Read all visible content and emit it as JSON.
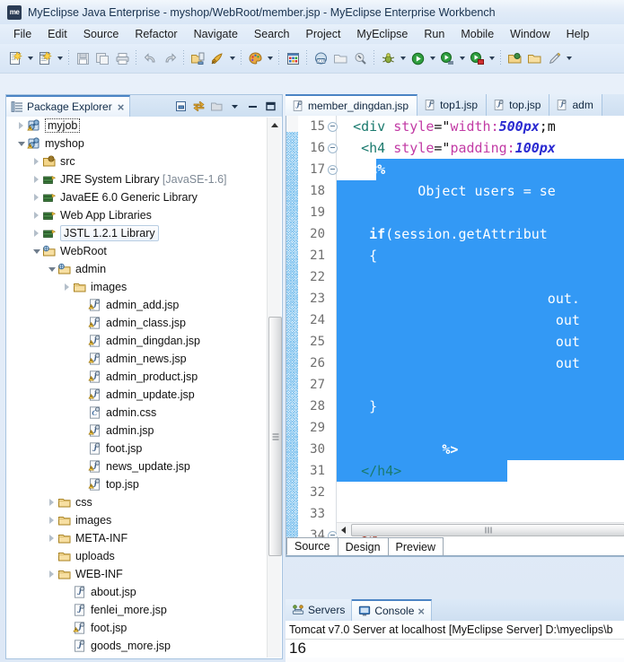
{
  "window": {
    "icon": "myeclipse-logo-icon",
    "title": "MyEclipse Java Enterprise - myshop/WebRoot/member.jsp - MyEclipse Enterprise Workbench"
  },
  "menubar": {
    "items": [
      {
        "label": "File"
      },
      {
        "label": "Edit"
      },
      {
        "label": "Source"
      },
      {
        "label": "Refactor"
      },
      {
        "label": "Navigate"
      },
      {
        "label": "Search"
      },
      {
        "label": "Project"
      },
      {
        "label": "MyEclipse"
      },
      {
        "label": "Run"
      },
      {
        "label": "Mobile"
      },
      {
        "label": "Window"
      },
      {
        "label": "Help"
      }
    ]
  },
  "toolbar": {
    "buttons": [
      {
        "name": "new-wizard-icon",
        "dropdown": true
      },
      {
        "name": "new-file-icon",
        "dropdown": true
      },
      {
        "name": "save-icon",
        "dropdown": false
      },
      {
        "name": "save-all-icon",
        "dropdown": false
      },
      {
        "name": "print-icon",
        "dropdown": false
      },
      {
        "name": "undo-icon",
        "dropdown": false
      },
      {
        "name": "redo-icon",
        "dropdown": false
      },
      {
        "name": "deploy-icon",
        "dropdown": false
      },
      {
        "name": "run-server-icon",
        "dropdown": true
      },
      {
        "name": "palette-icon",
        "dropdown": true
      },
      {
        "name": "database-explorer-icon",
        "dropdown": false
      },
      {
        "name": "web20-icon",
        "dropdown": false
      },
      {
        "name": "open-type-icon",
        "dropdown": false
      },
      {
        "name": "search-icon",
        "dropdown": false
      },
      {
        "name": "debug-icon",
        "dropdown": true
      },
      {
        "name": "run-icon",
        "dropdown": true
      },
      {
        "name": "run-external-icon",
        "dropdown": true
      },
      {
        "name": "run-profile-icon",
        "dropdown": true
      },
      {
        "name": "open-perspective-icon",
        "dropdown": false
      },
      {
        "name": "new-folder-icon",
        "dropdown": false
      },
      {
        "name": "edit-icon",
        "dropdown": true
      }
    ]
  },
  "package_explorer": {
    "tab_label": "Package Explorer",
    "tab_icon": "package-explorer-icon",
    "close_icon": "close-icon",
    "view_buttons": [
      {
        "name": "collapse-all-icon"
      },
      {
        "name": "link-with-editor-icon"
      },
      {
        "name": "focus-on-active-task-icon"
      },
      {
        "name": "view-menu-icon"
      },
      {
        "name": "minimize-view-icon"
      },
      {
        "name": "maximize-view-icon"
      }
    ],
    "tree": [
      {
        "label": "myjob",
        "indent": 0,
        "twisty": "collapsed",
        "icon": "java-project-warning-icon",
        "selected": "dotted"
      },
      {
        "label": "myshop",
        "indent": 0,
        "twisty": "expanded",
        "icon": "java-project-warning-icon"
      },
      {
        "label": "src",
        "indent": 1,
        "twisty": "collapsed",
        "icon": "source-folder-icon"
      },
      {
        "label": "JRE System Library",
        "suffix": " [JavaSE-1.6]",
        "indent": 1,
        "twisty": "collapsed",
        "icon": "library-icon"
      },
      {
        "label": "JavaEE 6.0 Generic Library",
        "indent": 1,
        "twisty": "collapsed",
        "icon": "library-icon"
      },
      {
        "label": "Web App Libraries",
        "indent": 1,
        "twisty": "collapsed",
        "icon": "library-icon"
      },
      {
        "label": "JSTL 1.2.1 Library",
        "indent": 1,
        "twisty": "collapsed",
        "icon": "library-icon",
        "selected": "box"
      },
      {
        "label": "WebRoot",
        "indent": 1,
        "twisty": "expanded",
        "icon": "web-folder-icon"
      },
      {
        "label": "admin",
        "indent": 2,
        "twisty": "expanded",
        "icon": "web-folder-icon"
      },
      {
        "label": "images",
        "indent": 3,
        "twisty": "collapsed",
        "icon": "folder-icon"
      },
      {
        "label": "admin_add.jsp",
        "indent": 4,
        "twisty": "none",
        "icon": "jsp-warning-icon"
      },
      {
        "label": "admin_class.jsp",
        "indent": 4,
        "twisty": "none",
        "icon": "jsp-warning-icon"
      },
      {
        "label": "admin_dingdan.jsp",
        "indent": 4,
        "twisty": "none",
        "icon": "jsp-warning-icon"
      },
      {
        "label": "admin_news.jsp",
        "indent": 4,
        "twisty": "none",
        "icon": "jsp-warning-icon"
      },
      {
        "label": "admin_product.jsp",
        "indent": 4,
        "twisty": "none",
        "icon": "jsp-warning-icon"
      },
      {
        "label": "admin_update.jsp",
        "indent": 4,
        "twisty": "none",
        "icon": "jsp-warning-icon"
      },
      {
        "label": "admin.css",
        "indent": 4,
        "twisty": "none",
        "icon": "css-icon"
      },
      {
        "label": "admin.jsp",
        "indent": 4,
        "twisty": "none",
        "icon": "jsp-warning-icon"
      },
      {
        "label": "foot.jsp",
        "indent": 4,
        "twisty": "none",
        "icon": "jsp-icon"
      },
      {
        "label": "news_update.jsp",
        "indent": 4,
        "twisty": "none",
        "icon": "jsp-warning-icon"
      },
      {
        "label": "top.jsp",
        "indent": 4,
        "twisty": "none",
        "icon": "jsp-warning-icon"
      },
      {
        "label": "css",
        "indent": 2,
        "twisty": "collapsed",
        "icon": "folder-icon"
      },
      {
        "label": "images",
        "indent": 2,
        "twisty": "collapsed",
        "icon": "folder-icon"
      },
      {
        "label": "META-INF",
        "indent": 2,
        "twisty": "collapsed",
        "icon": "folder-icon"
      },
      {
        "label": "uploads",
        "indent": 2,
        "twisty": "none",
        "icon": "folder-icon"
      },
      {
        "label": "WEB-INF",
        "indent": 2,
        "twisty": "collapsed",
        "icon": "folder-icon"
      },
      {
        "label": "about.jsp",
        "indent": 3,
        "twisty": "none",
        "icon": "jsp-icon"
      },
      {
        "label": "fenlei_more.jsp",
        "indent": 3,
        "twisty": "none",
        "icon": "jsp-icon"
      },
      {
        "label": "foot.jsp",
        "indent": 3,
        "twisty": "none",
        "icon": "jsp-warning-icon"
      },
      {
        "label": "goods_more.jsp",
        "indent": 3,
        "twisty": "none",
        "icon": "jsp-icon"
      }
    ]
  },
  "editor": {
    "tabs": [
      {
        "label": "member_dingdan.jsp",
        "icon": "jsp-icon",
        "active": true
      },
      {
        "label": "top1.jsp",
        "icon": "jsp-icon",
        "active": false
      },
      {
        "label": "top.jsp",
        "icon": "jsp-icon",
        "active": false
      },
      {
        "label": "adm",
        "icon": "jsp-icon",
        "active": false
      }
    ],
    "bottom_tabs": [
      {
        "label": "Source",
        "active": true
      },
      {
        "label": "Design",
        "active": false
      },
      {
        "label": "Preview",
        "active": false
      }
    ],
    "selection_color": "#3399f5",
    "lines": [
      {
        "num": "15",
        "fold": true,
        "segments": [
          {
            "t": "  ",
            "c": "tk-plain"
          },
          {
            "t": "<div ",
            "c": "tk-tag"
          },
          {
            "t": "style",
            "c": "tk-attr"
          },
          {
            "t": "=\"",
            "c": "tk-plain"
          },
          {
            "t": "width:",
            "c": "tk-attr"
          },
          {
            "t": "500px",
            "c": "tk-strI"
          },
          {
            "t": ";m",
            "c": "tk-plain"
          }
        ]
      },
      {
        "num": "16",
        "fold": true,
        "segments": [
          {
            "t": "   ",
            "c": "tk-plain"
          },
          {
            "t": "<h4 ",
            "c": "tk-tag"
          },
          {
            "t": "style",
            "c": "tk-attr"
          },
          {
            "t": "=\"",
            "c": "tk-plain"
          },
          {
            "t": "padding:",
            "c": "tk-attr"
          },
          {
            "t": "100px",
            "c": "tk-strI"
          }
        ]
      },
      {
        "num": "17",
        "fold": true,
        "segments": [
          {
            "t": "    <%",
            "c": "on-sel-b"
          }
        ]
      },
      {
        "num": "18",
        "fold": false,
        "segments": [
          {
            "t": "          Object users = se",
            "c": "on-sel"
          }
        ]
      },
      {
        "num": "19",
        "fold": false,
        "segments": []
      },
      {
        "num": "20",
        "fold": false,
        "segments": [
          {
            "t": "    if",
            "c": "on-sel-b"
          },
          {
            "t": "(session.getAttribut",
            "c": "on-sel"
          }
        ]
      },
      {
        "num": "21",
        "fold": false,
        "segments": [
          {
            "t": "    {",
            "c": "on-sel"
          }
        ]
      },
      {
        "num": "22",
        "fold": false,
        "segments": []
      },
      {
        "num": "23",
        "fold": false,
        "segments": [
          {
            "t": "                          out.",
            "c": "on-sel"
          }
        ]
      },
      {
        "num": "24",
        "fold": false,
        "segments": [
          {
            "t": "                           out",
            "c": "on-sel"
          }
        ]
      },
      {
        "num": "25",
        "fold": false,
        "segments": [
          {
            "t": "                           out",
            "c": "on-sel"
          }
        ]
      },
      {
        "num": "26",
        "fold": false,
        "segments": [
          {
            "t": "                           out",
            "c": "on-sel"
          }
        ]
      },
      {
        "num": "27",
        "fold": false,
        "segments": []
      },
      {
        "num": "28",
        "fold": false,
        "segments": [
          {
            "t": "    }",
            "c": "on-sel"
          }
        ]
      },
      {
        "num": "29",
        "fold": false,
        "segments": []
      },
      {
        "num": "30",
        "fold": false,
        "segments": [
          {
            "t": "             %>",
            "c": "on-sel-b"
          }
        ]
      },
      {
        "num": "31",
        "fold": false,
        "segments": [
          {
            "t": "   ",
            "c": "tk-plain"
          },
          {
            "t": "</h4>",
            "c": "tk-tag"
          }
        ]
      },
      {
        "num": "32",
        "fold": false,
        "segments": []
      },
      {
        "num": "33",
        "fold": false,
        "segments": []
      },
      {
        "num": "34",
        "fold": true,
        "segments": [
          {
            "t": "   ",
            "c": "tk-plain"
          },
          {
            "t": "<%",
            "c": "tk-scr"
          }
        ]
      }
    ]
  },
  "console": {
    "tabs": [
      {
        "label": "Servers",
        "icon": "servers-icon",
        "active": false,
        "closable": false
      },
      {
        "label": "Console",
        "icon": "console-icon",
        "active": true,
        "closable": true
      }
    ],
    "close_icon": "close-icon",
    "title": "Tomcat v7.0 Server at localhost [MyEclipse Server] D:\\myeclips\\b",
    "output": "16"
  }
}
